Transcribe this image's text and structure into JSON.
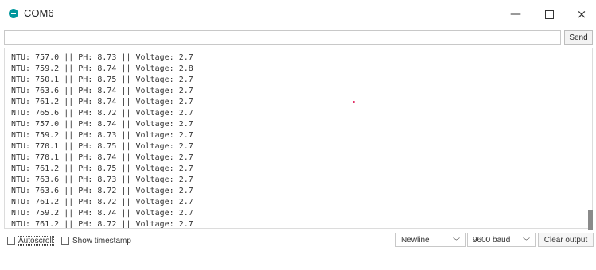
{
  "window": {
    "title": "COM6",
    "minimize_glyph": "—",
    "close_glyph": "×",
    "accent": "#00979d"
  },
  "input": {
    "value": "",
    "send_label": "Send"
  },
  "output": {
    "lines": [
      "NTU: 757.0 || PH: 8.73 || Voltage: 2.7",
      "NTU: 759.2 || PH: 8.74 || Voltage: 2.8",
      "NTU: 750.1 || PH: 8.75 || Voltage: 2.7",
      "NTU: 763.6 || PH: 8.74 || Voltage: 2.7",
      "NTU: 761.2 || PH: 8.74 || Voltage: 2.7",
      "NTU: 765.6 || PH: 8.72 || Voltage: 2.7",
      "NTU: 757.0 || PH: 8.74 || Voltage: 2.7",
      "NTU: 759.2 || PH: 8.73 || Voltage: 2.7",
      "NTU: 770.1 || PH: 8.75 || Voltage: 2.7",
      "NTU: 770.1 || PH: 8.74 || Voltage: 2.7",
      "NTU: 761.2 || PH: 8.75 || Voltage: 2.7",
      "NTU: 763.6 || PH: 8.73 || Voltage: 2.7",
      "NTU: 763.6 || PH: 8.72 || Voltage: 2.7",
      "NTU: 761.2 || PH: 8.72 || Voltage: 2.7",
      "NTU: 759.2 || PH: 8.74 || Voltage: 2.7",
      "NTU: 761.2 || PH: 8.72 || Voltage: 2.7"
    ]
  },
  "footer": {
    "autoscroll_label": "Autoscroll",
    "autoscroll_checked": false,
    "timestamp_label": "Show timestamp",
    "timestamp_checked": false,
    "line_ending": "Newline",
    "baud_rate": "9600 baud",
    "clear_label": "Clear output"
  }
}
